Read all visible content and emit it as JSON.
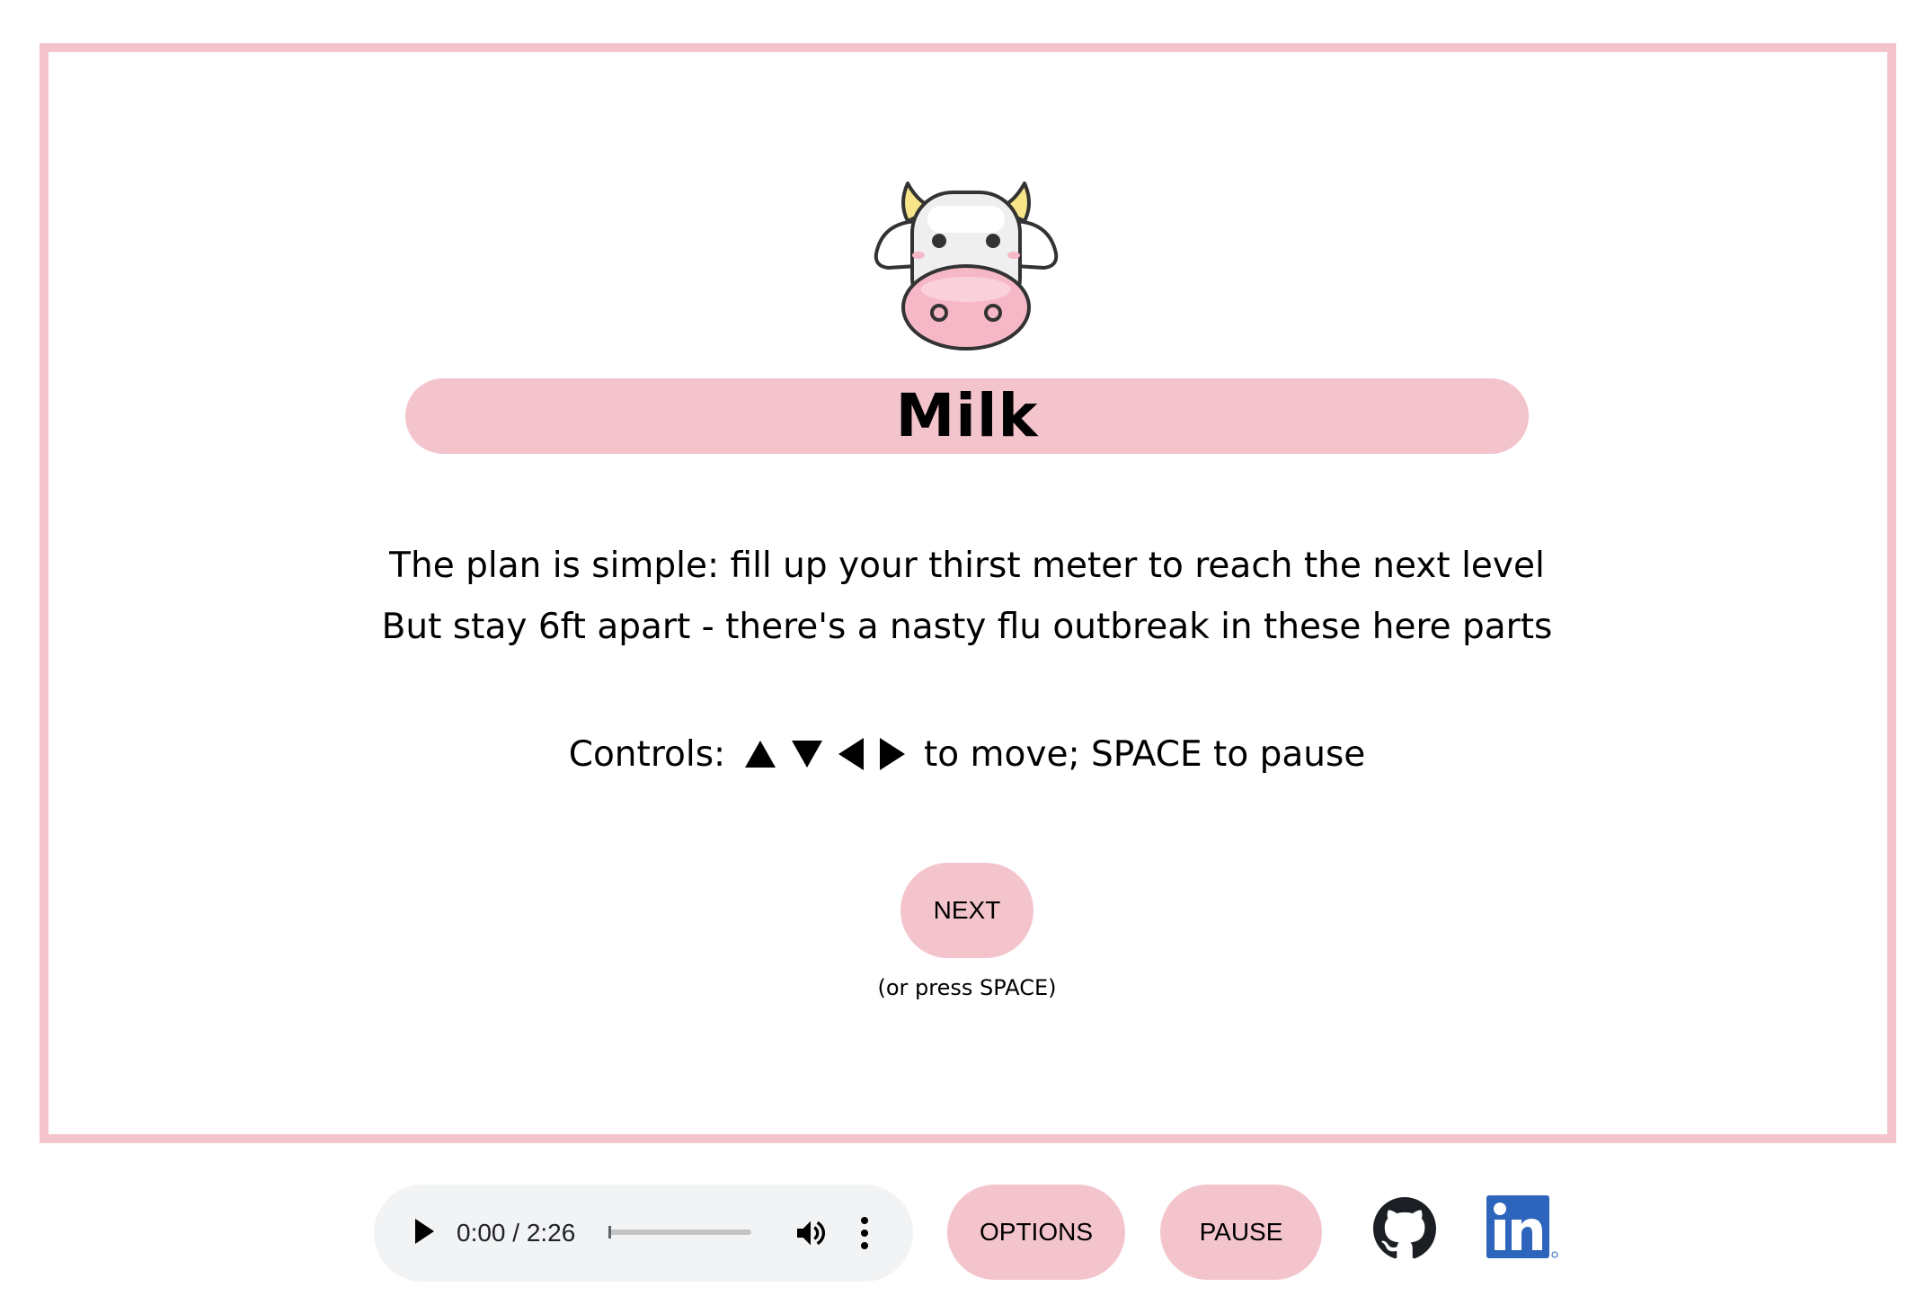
{
  "level": {
    "title": "Milk",
    "description_lines": [
      "The plan is simple: fill up your thirst meter to reach the next level",
      "But stay 6ft apart - there's a nasty flu outbreak in these here parts"
    ],
    "controls_prefix": "Controls:",
    "controls_suffix": "to move; SPACE to pause",
    "next_label": "NEXT",
    "next_hint": "(or press SPACE)"
  },
  "audio": {
    "time_display": "0:00 / 2:26",
    "progress_fraction": 0.0
  },
  "footer": {
    "options_label": "OPTIONS",
    "pause_label": "PAUSE"
  },
  "icons": {
    "mascot": "cow-icon",
    "github": "github-icon",
    "linkedin": "linkedin-icon"
  },
  "colors": {
    "accent_pink": "#f4c4cc",
    "text": "#000000",
    "audio_bg": "#f1f3f4",
    "linkedin_blue": "#2d64bc"
  }
}
